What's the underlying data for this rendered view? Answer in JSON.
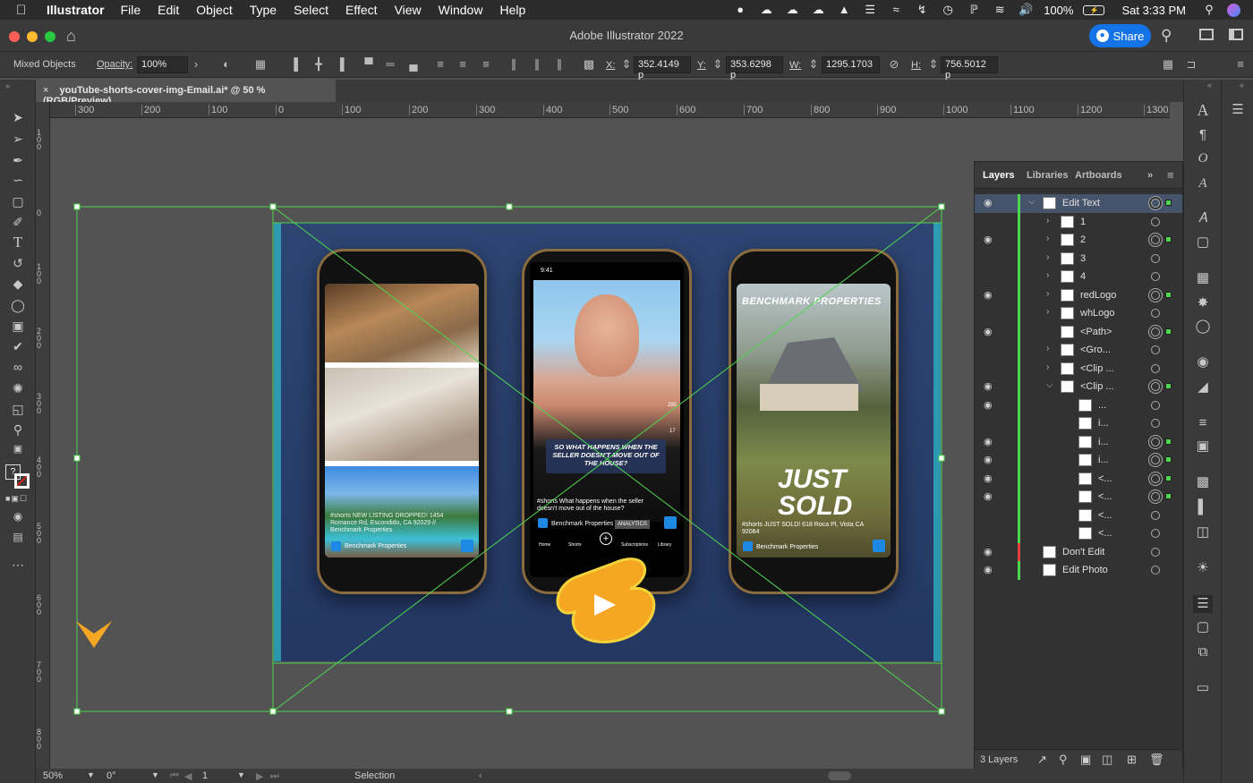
{
  "menubar": {
    "app_name": "Illustrator",
    "menus": [
      "File",
      "Edit",
      "Object",
      "Type",
      "Select",
      "Effect",
      "View",
      "Window",
      "Help"
    ],
    "battery": "100%",
    "clock": "Sat 3:33 PM"
  },
  "titlebar": {
    "title": "Adobe Illustrator 2022",
    "share_label": "Share"
  },
  "control": {
    "selection_type": "Mixed Objects",
    "opacity_label": "Opacity:",
    "opacity_value": "100%",
    "x_label": "X:",
    "x_value": "352.4149 p",
    "y_label": "Y:",
    "y_value": "353.6298 p",
    "w_label": "W:",
    "w_value": "1295.1703 ",
    "h_label": "H:",
    "h_value": "756.5012 p"
  },
  "document": {
    "tab_title": "youTube-shorts-cover-img-Email.ai* @ 50 % (RGB/Preview)"
  },
  "ruler": {
    "h_labels": [
      "300",
      "200",
      "100",
      "0",
      "100",
      "200",
      "300",
      "400",
      "500",
      "600",
      "700",
      "800",
      "900",
      "1000",
      "1100",
      "1200",
      "1300"
    ],
    "v_labels": [
      "100",
      "0",
      "100",
      "200",
      "300",
      "400",
      "500",
      "600",
      "700",
      "800"
    ]
  },
  "phones": {
    "left_caption": "#shorts NEW LISTING DROPPED! 1454 Romance Rd, Escondido, CA 92029 // Benchmark Properties",
    "left_channel": "Benchmark Properties",
    "center_time": "9:41",
    "center_overlay": "SO WHAT HAPPENS WHEN THE SELLER DOESN'T MOVE OUT OF THE HOUSE?",
    "center_caption": "#shorts What happens when the seller doesn't move out of the house?",
    "center_channel": "Benchmark Properties",
    "center_analytics": "ANALYTICS",
    "center_nav": [
      "Home",
      "Shorts",
      "",
      "Subscriptions",
      "Library"
    ],
    "right_brand": "BENCHMARK PROPERTIES",
    "right_headline_1": "JUST",
    "right_headline_2": "SOLD",
    "right_caption": "#shorts JUST SOLD! 618 Roca Pl, Vista CA 92084",
    "right_channel": "Benchmark Properties",
    "like_count": "285",
    "dislike_count": "17"
  },
  "layers_panel": {
    "tabs": [
      "Layers",
      "Libraries",
      "Artboards"
    ],
    "rows": [
      {
        "name": "Edit Text",
        "level": 0,
        "eye": true,
        "twirl": "down",
        "bar": "#4fd64f",
        "sel": true,
        "selected": true
      },
      {
        "name": "1",
        "level": 1,
        "eye": false,
        "twirl": "right",
        "bar": "#4fd64f",
        "sel": false
      },
      {
        "name": "2",
        "level": 1,
        "eye": true,
        "twirl": "right",
        "bar": "#4fd64f",
        "sel": true
      },
      {
        "name": "3",
        "level": 1,
        "eye": false,
        "twirl": "right",
        "bar": "#4fd64f",
        "sel": false
      },
      {
        "name": "4",
        "level": 1,
        "eye": false,
        "twirl": "right",
        "bar": "#4fd64f",
        "sel": false
      },
      {
        "name": "redLogo",
        "level": 1,
        "eye": true,
        "twirl": "right",
        "bar": "#4fd64f",
        "sel": true
      },
      {
        "name": "whLogo",
        "level": 1,
        "eye": false,
        "twirl": "right",
        "bar": "#4fd64f",
        "sel": false
      },
      {
        "name": "<Path>",
        "level": 1,
        "eye": true,
        "twirl": "",
        "bar": "#4fd64f",
        "sel": true
      },
      {
        "name": "<Gro...",
        "level": 1,
        "eye": false,
        "twirl": "right",
        "bar": "#4fd64f",
        "sel": false
      },
      {
        "name": "<Clip ...",
        "level": 1,
        "eye": false,
        "twirl": "right",
        "bar": "#4fd64f",
        "sel": false
      },
      {
        "name": "<Clip ...",
        "level": 1,
        "eye": true,
        "twirl": "down",
        "bar": "#4fd64f",
        "sel": true
      },
      {
        "name": "...",
        "level": 2,
        "eye": true,
        "twirl": "",
        "bar": "#4fd64f",
        "sel": false
      },
      {
        "name": "i...",
        "level": 2,
        "eye": false,
        "twirl": "",
        "bar": "#4fd64f",
        "sel": false
      },
      {
        "name": "i...",
        "level": 2,
        "eye": true,
        "twirl": "",
        "bar": "#4fd64f",
        "sel": true
      },
      {
        "name": "i...",
        "level": 2,
        "eye": true,
        "twirl": "",
        "bar": "#4fd64f",
        "sel": true
      },
      {
        "name": "<...",
        "level": 2,
        "eye": true,
        "twirl": "",
        "bar": "#4fd64f",
        "sel": true
      },
      {
        "name": "<...",
        "level": 2,
        "eye": true,
        "twirl": "",
        "bar": "#4fd64f",
        "sel": true
      },
      {
        "name": "<...",
        "level": 2,
        "eye": false,
        "twirl": "",
        "bar": "#4fd64f",
        "sel": false
      },
      {
        "name": "<...",
        "level": 2,
        "eye": false,
        "twirl": "",
        "bar": "#4fd64f",
        "sel": false
      },
      {
        "name": "Don't Edit",
        "level": 0,
        "eye": true,
        "twirl": "",
        "bar": "#e04040",
        "sel": false
      },
      {
        "name": "Edit Photo",
        "level": 0,
        "eye": true,
        "twirl": "",
        "bar": "#4fd64f",
        "sel": false
      }
    ],
    "layer_count": "3 Layers"
  },
  "status": {
    "zoom": "50%",
    "rotation": "0°",
    "artboard": "1",
    "tool": "Selection"
  },
  "colors": {
    "accent": "#1473e6",
    "selection_green": "#4fd64f",
    "artboard_blue": "#2a3f6e",
    "shorts_orange": "#f5a623"
  }
}
